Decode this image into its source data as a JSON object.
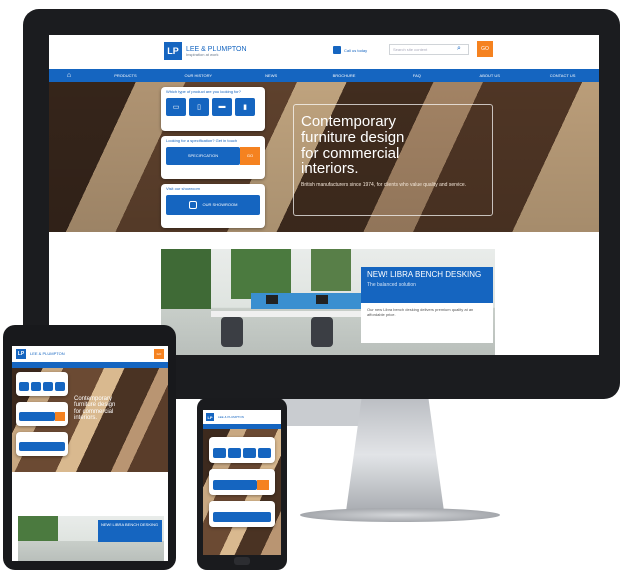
{
  "brand": {
    "name": "LEE & PLUMPTON",
    "tagline": "Inspiration at work",
    "logo_mark": "LP"
  },
  "header": {
    "phone_label": "Call us today",
    "search_placeholder": "Search site content",
    "search_button_label": "GO"
  },
  "nav": {
    "home_icon": "home-icon",
    "items": [
      "PRODUCTS",
      "OUR HISTORY",
      "NEWS",
      "BROCHURE",
      "FAQ",
      "ABOUT US",
      "CONTACT US"
    ]
  },
  "hero": {
    "title_lines": [
      "Contemporary",
      "furniture design",
      "for commercial",
      "interiors."
    ],
    "subtitle": "British manufacturers since 1974, for clients who value quality and service.",
    "card1_label": "Which type of product are you looking for?",
    "card1_icons": [
      "desk-icon",
      "seating-icon",
      "storage-icon",
      "screen-icon"
    ],
    "card2_label": "Looking for a specification? Get in touch",
    "card2_button": "SPECIFICATION",
    "card2_go": "GO",
    "card3_label": "Visit our showroom",
    "card3_button": "OUR SHOWROOM"
  },
  "promo": {
    "title": "NEW! LIBRA BENCH DESKING",
    "subtitle": "The balanced solution",
    "body": "Our new Libra bench desking delivers premium quality at an affordable price."
  },
  "colors": {
    "brand_blue": "#1565c0",
    "accent_orange": "#f58220",
    "device_black": "#1b1c1f"
  }
}
